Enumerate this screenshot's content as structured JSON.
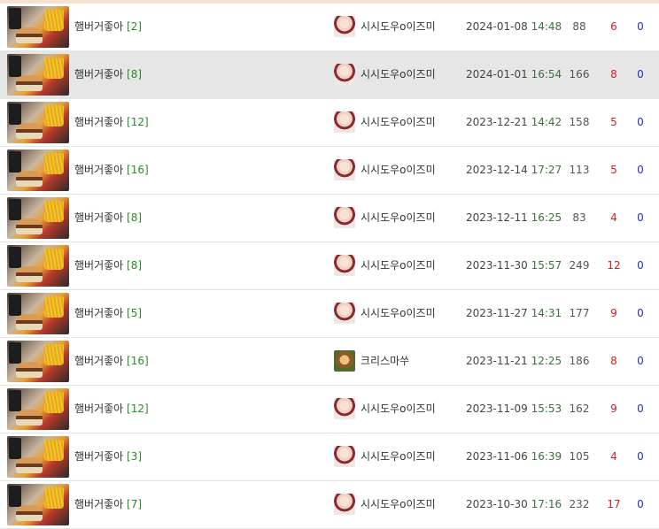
{
  "posts": [
    {
      "title": "햄버거좋아",
      "comments": "[2]",
      "author": "시시도우o이즈미",
      "avatar": "anime-avatar-icon",
      "date": "2024-01-08",
      "time": "14:48",
      "views": "88",
      "recommends": "6",
      "nonrec": "0"
    },
    {
      "title": "햄버거좋아",
      "comments": "[8]",
      "author": "시시도우o이즈미",
      "avatar": "anime-avatar-icon",
      "date": "2024-01-01",
      "time": "16:54",
      "views": "166",
      "recommends": "8",
      "nonrec": "0",
      "selected": true
    },
    {
      "title": "햄버거좋아",
      "comments": "[12]",
      "author": "시시도우o이즈미",
      "avatar": "anime-avatar-icon",
      "date": "2023-12-21",
      "time": "14:42",
      "views": "158",
      "recommends": "5",
      "nonrec": "0"
    },
    {
      "title": "햄버거좋아",
      "comments": "[16]",
      "author": "시시도우o이즈미",
      "avatar": "anime-avatar-icon",
      "date": "2023-12-14",
      "time": "17:27",
      "views": "113",
      "recommends": "5",
      "nonrec": "0"
    },
    {
      "title": "햄버거좋아",
      "comments": "[8]",
      "author": "시시도우o이즈미",
      "avatar": "anime-avatar-icon",
      "date": "2023-12-11",
      "time": "16:25",
      "views": "83",
      "recommends": "4",
      "nonrec": "0"
    },
    {
      "title": "햄버거좋아",
      "comments": "[8]",
      "author": "시시도우o이즈미",
      "avatar": "anime-avatar-icon",
      "date": "2023-11-30",
      "time": "15:57",
      "views": "249",
      "recommends": "12",
      "nonrec": "0"
    },
    {
      "title": "햄버거좋아",
      "comments": "[5]",
      "author": "시시도우o이즈미",
      "avatar": "anime-avatar-icon",
      "date": "2023-11-27",
      "time": "14:31",
      "views": "177",
      "recommends": "9",
      "nonrec": "0"
    },
    {
      "title": "햄버거좋아",
      "comments": "[16]",
      "author": "크리스마쑤",
      "avatar": "cartoon-avatar-icon",
      "date": "2023-11-21",
      "time": "12:25",
      "views": "186",
      "recommends": "8",
      "nonrec": "0"
    },
    {
      "title": "햄버거좋아",
      "comments": "[12]",
      "author": "시시도우o이즈미",
      "avatar": "anime-avatar-icon",
      "date": "2023-11-09",
      "time": "15:53",
      "views": "162",
      "recommends": "9",
      "nonrec": "0"
    },
    {
      "title": "햄버거좋아",
      "comments": "[3]",
      "author": "시시도우o이즈미",
      "avatar": "anime-avatar-icon",
      "date": "2023-11-06",
      "time": "16:39",
      "views": "105",
      "recommends": "4",
      "nonrec": "0"
    },
    {
      "title": "햄버거좋아",
      "comments": "[7]",
      "author": "시시도우o이즈미",
      "avatar": "anime-avatar-icon",
      "date": "2023-10-30",
      "time": "17:16",
      "views": "232",
      "recommends": "17",
      "nonrec": "0"
    }
  ],
  "colors": {
    "comment_count": "#2a8a2a",
    "time": "#3f6f3f",
    "recommends": "#d02020",
    "nonrec": "#2a2acc",
    "selected_row": "#e6e6e6"
  }
}
